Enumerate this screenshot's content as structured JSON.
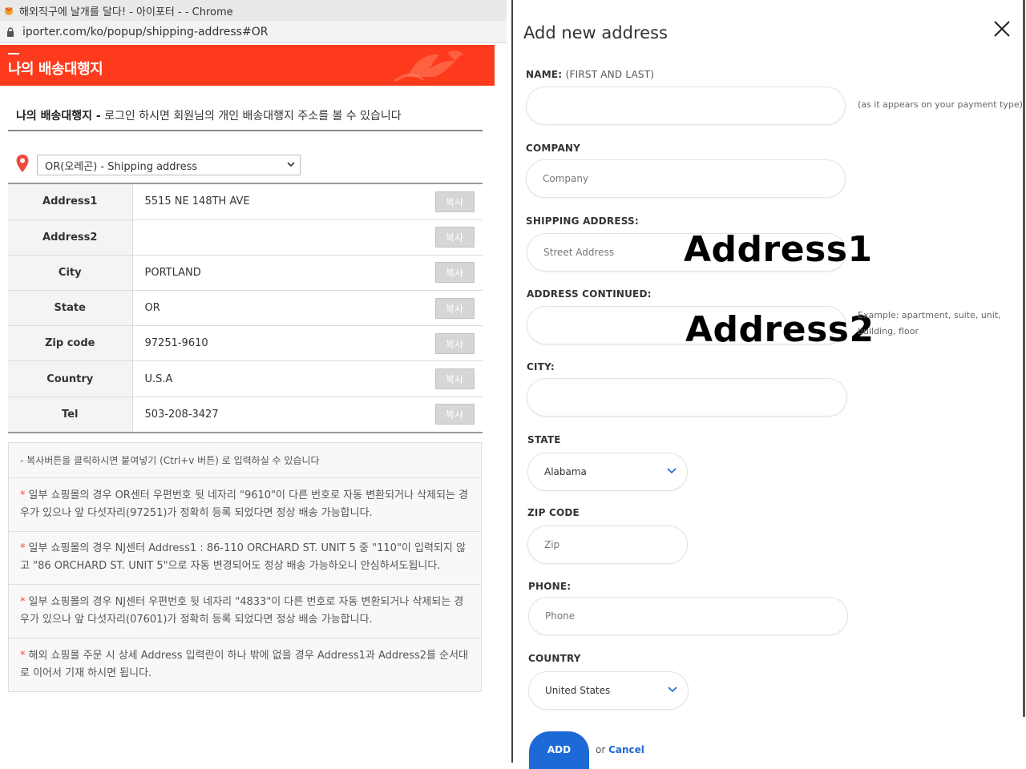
{
  "browser": {
    "window_title": "해외직구에 날개를 달다! - 아이포터 - - Chrome",
    "url": "iporter.com/ko/popup/shipping-address#OR"
  },
  "popup": {
    "banner_title": "나의 배송대행지",
    "subtitle_bold": "나의 배송대행지 -",
    "subtitle_text": " 로그인 하시면 회원님의 개인 배송대행지 주소를 볼 수 있습니다",
    "selected_address": "OR(오레곤) - Shipping address",
    "copy_label": "복사",
    "rows": [
      {
        "key": "Address1",
        "value": "5515 NE 148TH AVE"
      },
      {
        "key": "Address2",
        "value": ""
      },
      {
        "key": "City",
        "value": "PORTLAND"
      },
      {
        "key": "State",
        "value": "OR"
      },
      {
        "key": "Zip code",
        "value": "97251-9610"
      },
      {
        "key": "Country",
        "value": "U.S.A"
      },
      {
        "key": "Tel",
        "value": "503-208-3427"
      }
    ],
    "notes": [
      "- 복사버튼을 클릭하시면 붙여넣기 (Ctrl+v 버튼) 로 입력하실 수 있습니다",
      "일부 쇼핑몰의 경우 OR센터 우편번호 뒷 네자리 \"9610\"이 다른 번호로 자동 변환되거나 삭제되는 경우가 있으나 앞 다섯자리(97251)가 정확히 등록 되었다면 정상 배송 가능합니다.",
      "일부 쇼핑몰의 경우 NJ센터  Address1 : 86-110 ORCHARD ST. UNIT 5 중 \"110\"이 입력되지 않고 \"86 ORCHARD ST. UNIT 5\"으로 자동 변경되어도 정상 배송 가능하오니 안심하셔도됩니다.",
      "일부 쇼핑몰의 경우 NJ센터 우편번호 뒷 네자리 \"4833\"이 다른 번호로 자동 변환되거나 삭제되는 경우가 있으나 앞 다섯자리(07601)가 정확히 등록 되었다면 정상 배송 가능합니다.",
      "해외 쇼핑몰 주문 시 상세 Address 입력란이 하나 밖에 없을 경우 Address1과 Address2를 순서대로 이어서 기재 하시면 됩니다."
    ]
  },
  "form": {
    "title": "Add new address",
    "close_symbol": "X",
    "name_label": "NAME:",
    "name_label_sub": "(FIRST AND LAST)",
    "name_hint": "(as it appears on your payment type)",
    "company_label": "COMPANY",
    "company_placeholder": "Company",
    "shipping_label": "SHIPPING ADDRESS:",
    "street_placeholder": "Street Address",
    "annotation1": "Address1",
    "continued_label": "ADDRESS CONTINUED:",
    "annotation2": "Address2",
    "continued_hint": "Example: apartment, suite, unit, building, floor",
    "city_label": "CITY:",
    "state_label": "STATE",
    "state_value": "Alabama",
    "zip_label": "ZIP CODE",
    "zip_placeholder": "Zip",
    "phone_label": "PHONE:",
    "phone_placeholder": "Phone",
    "country_label": "COUNTRY",
    "country_value": "United States",
    "add_label": "ADD",
    "or_text": "or",
    "cancel_label": "Cancel"
  },
  "colors": {
    "banner": "#fd3b1c",
    "accent_blue": "#1d69d6",
    "note_star": "#f04b3a"
  }
}
